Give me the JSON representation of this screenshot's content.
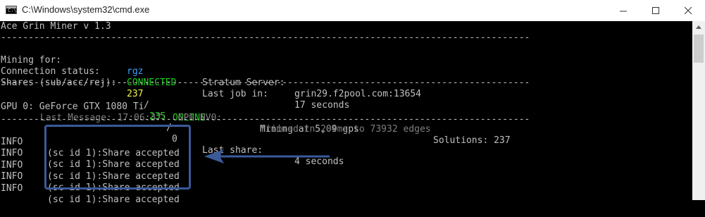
{
  "window": {
    "title": "C:\\Windows\\system32\\cmd.exe"
  },
  "console": {
    "header": "Ace Grin Miner v 1.3",
    "separator": "------------------------------------------------------------------------------------------------",
    "mining_for_label": "Mining for:",
    "mining_for_value": "rgz",
    "stratum_label": "Stratum Server:",
    "stratum_value": "grin29.f2pool.com:13654",
    "connection_label": "Connection status:",
    "connection_value": "CONNECTED",
    "last_job_label": "Last job in:",
    "last_job_value": "17 seconds",
    "shares_label": "Shares (sub/acc/rej):",
    "shares_sub": "237",
    "shares_slash1": "/",
    "shares_acc": "235",
    "shares_slash2": "/",
    "shares_rej": "0",
    "last_share_label": "Last share:",
    "last_share_value": "4 seconds",
    "gpu_label": "GPU 0: GeForce GTX 1080 Ti",
    "gpu_status": "ONLINE",
    "gpu_rate": "Mining at 5,09 gps",
    "gpu_solutions": "Solutions: 237",
    "last_message": "Last Message: 17:06:37:  GPU NV0:",
    "trimmed": "Trimmed in 204ms to 73932 edges",
    "log": [
      {
        "level": "INFO",
        "message": "(sc id 1):Share accepted"
      },
      {
        "level": "INFO",
        "message": "(sc id 1):Share accepted"
      },
      {
        "level": "INFO",
        "message": "(sc id 1):Share accepted"
      },
      {
        "level": "INFO",
        "message": "(sc id 1):Share accepted"
      },
      {
        "level": "INFO",
        "message": "(sc id 1):Share accepted"
      }
    ]
  },
  "colors": {
    "annotation": "#3a5a9a",
    "online_green": "#22d022",
    "value_cyan": "#3aa0ff",
    "count_yellow": "#f2f24a"
  },
  "icons": [
    "cmd-app-icon",
    "minimize-icon",
    "maximize-icon",
    "close-icon",
    "scroll-up-icon",
    "annotation-arrow"
  ]
}
